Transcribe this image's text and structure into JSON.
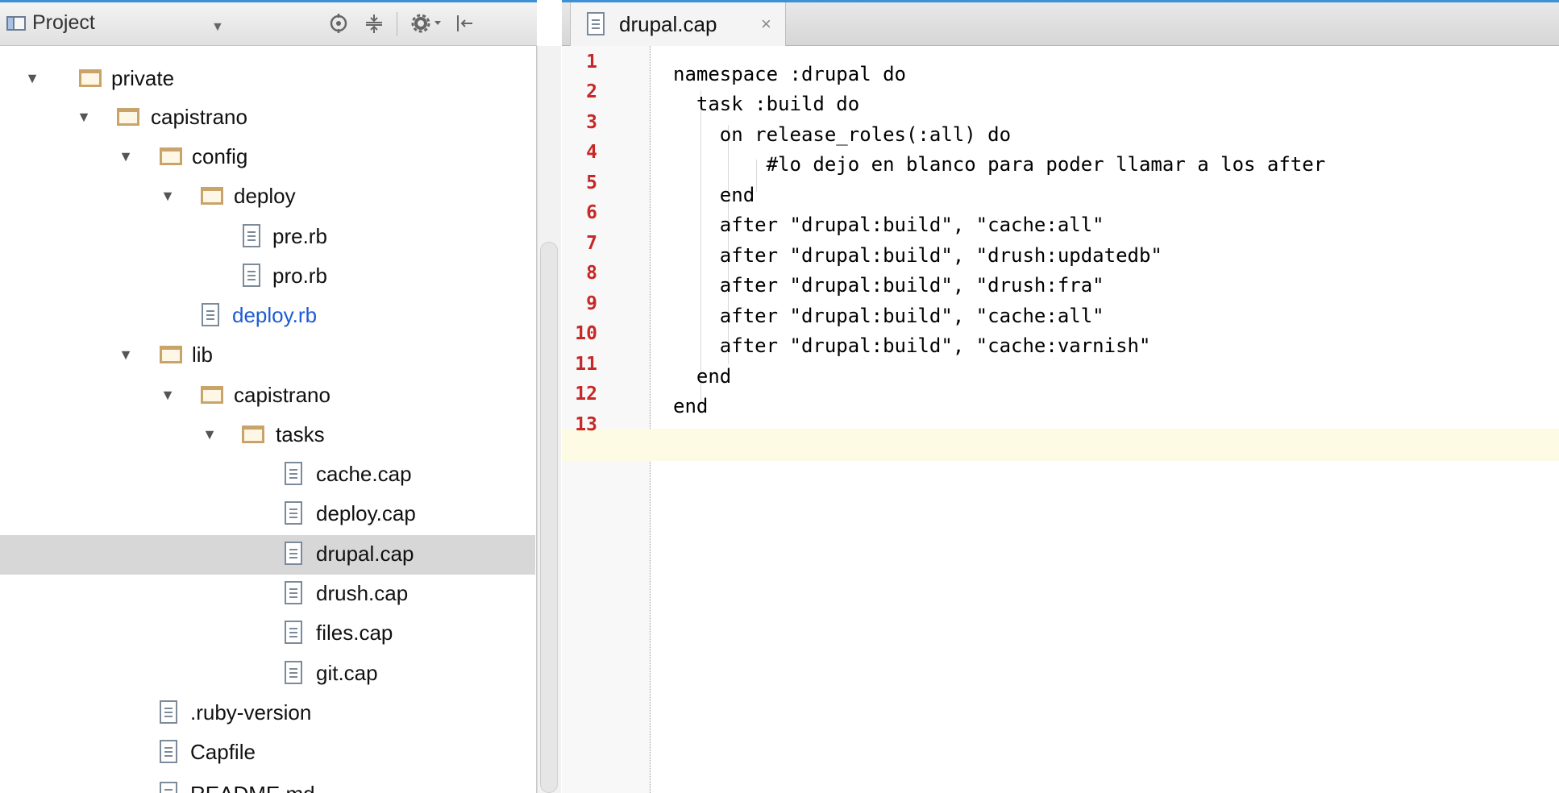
{
  "project_panel": {
    "title": "Project",
    "tree": [
      {
        "label": "private",
        "kind": "folder",
        "expanded": true,
        "depth": 0
      },
      {
        "label": "capistrano",
        "kind": "folder",
        "expanded": true,
        "depth": 1
      },
      {
        "label": "config",
        "kind": "folder",
        "expanded": true,
        "depth": 2
      },
      {
        "label": "deploy",
        "kind": "folder",
        "expanded": true,
        "depth": 3
      },
      {
        "label": "pre.rb",
        "kind": "file",
        "depth": 4
      },
      {
        "label": "pro.rb",
        "kind": "file",
        "depth": 4
      },
      {
        "label": "deploy.rb",
        "kind": "file",
        "depth": 3,
        "highlight": "modified"
      },
      {
        "label": "lib",
        "kind": "folder",
        "expanded": true,
        "depth": 2
      },
      {
        "label": "capistrano",
        "kind": "folder",
        "expanded": true,
        "depth": 3
      },
      {
        "label": "tasks",
        "kind": "folder",
        "expanded": true,
        "depth": 4
      },
      {
        "label": "cache.cap",
        "kind": "file",
        "depth": 5
      },
      {
        "label": "deploy.cap",
        "kind": "file",
        "depth": 5
      },
      {
        "label": "drupal.cap",
        "kind": "file",
        "depth": 5,
        "selected": true
      },
      {
        "label": "drush.cap",
        "kind": "file",
        "depth": 5
      },
      {
        "label": "files.cap",
        "kind": "file",
        "depth": 5
      },
      {
        "label": "git.cap",
        "kind": "file",
        "depth": 5
      },
      {
        "label": ".ruby-version",
        "kind": "file",
        "depth": 3
      },
      {
        "label": "Capfile",
        "kind": "file",
        "depth": 3
      },
      {
        "label": "README.md",
        "kind": "file",
        "depth": 3
      }
    ]
  },
  "editor": {
    "tab_label": "drupal.cap",
    "tab_close": "×",
    "lines": [
      "namespace :drupal do",
      "  task :build do",
      "    on release_roles(:all) do",
      "        #lo dejo en blanco para poder llamar a los after",
      "    end",
      "    after \"drupal:build\", \"cache:all\"",
      "    after \"drupal:build\", \"drush:updatedb\"",
      "    after \"drupal:build\", \"drush:fra\"",
      "    after \"drupal:build\", \"cache:all\"",
      "    after \"drupal:build\", \"cache:varnish\"",
      "  end",
      "end",
      ""
    ],
    "line_numbers": [
      "1",
      "2",
      "3",
      "4",
      "5",
      "6",
      "7",
      "8",
      "9",
      "10",
      "11",
      "12",
      "13"
    ]
  },
  "colors": {
    "accent": "#3d8fd6",
    "line_number": "#c62828",
    "modified_file": "#1d5cd3",
    "selected_row": "#d7d7d7",
    "current_line": "#fdfbe3"
  }
}
